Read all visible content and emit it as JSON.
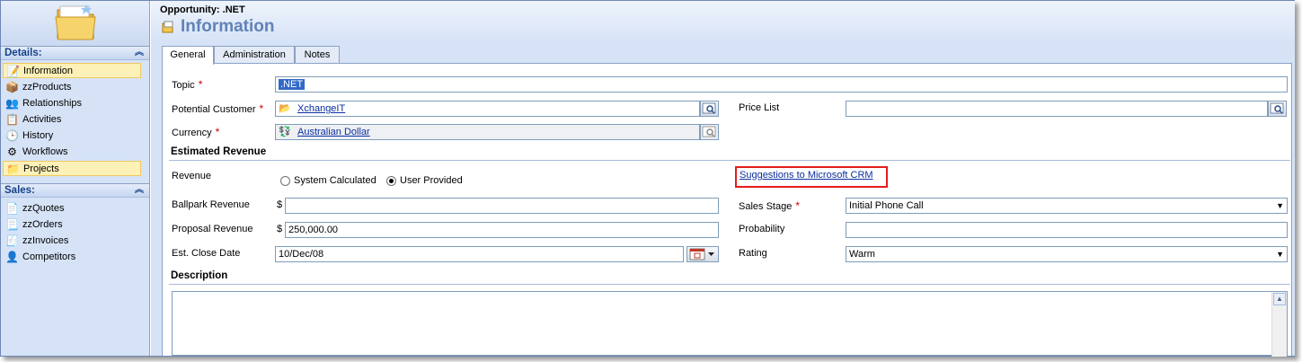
{
  "header": {
    "entity": "Opportunity: .NET",
    "title": "Information"
  },
  "sidebar": {
    "details_title": "Details:",
    "details_items": [
      {
        "label": "Information",
        "icon": "information-icon"
      },
      {
        "label": "zzProducts",
        "icon": "products-icon"
      },
      {
        "label": "Relationships",
        "icon": "relationships-icon"
      },
      {
        "label": "Activities",
        "icon": "activities-icon"
      },
      {
        "label": "History",
        "icon": "history-icon"
      },
      {
        "label": "Workflows",
        "icon": "workflows-icon"
      },
      {
        "label": "Projects",
        "icon": "projects-icon"
      }
    ],
    "sales_title": "Sales:",
    "sales_items": [
      {
        "label": "zzQuotes",
        "icon": "quotes-icon"
      },
      {
        "label": "zzOrders",
        "icon": "orders-icon"
      },
      {
        "label": "zzInvoices",
        "icon": "invoices-icon"
      },
      {
        "label": "Competitors",
        "icon": "competitors-icon"
      }
    ]
  },
  "tabs": [
    {
      "label": "General"
    },
    {
      "label": "Administration"
    },
    {
      "label": "Notes"
    }
  ],
  "form": {
    "topic_label": "Topic",
    "topic_value": ".NET",
    "customer_label": "Potential Customer",
    "customer_value": "XchangeIT",
    "currency_label": "Currency",
    "currency_value": "Australian Dollar",
    "pricelist_label": "Price List",
    "pricelist_value": "",
    "required_mark": "*",
    "section_revenue": "Estimated Revenue",
    "revenue_label": "Revenue",
    "revenue_opt1": "System Calculated",
    "revenue_opt2": "User Provided",
    "suggest_link": "Suggestions to Microsoft CRM",
    "ballpark_label": "Ballpark Revenue",
    "ballpark_currency": "$",
    "ballpark_value": "",
    "proposal_label": "Proposal Revenue",
    "proposal_currency": "$",
    "proposal_value": "250,000.00",
    "close_label": "Est. Close Date",
    "close_value": "10/Dec/08",
    "stage_label": "Sales Stage",
    "stage_value": "Initial Phone Call",
    "probability_label": "Probability",
    "probability_value": "",
    "rating_label": "Rating",
    "rating_value": "Warm",
    "section_description": "Description"
  },
  "colors": {
    "accent": "#6183b8",
    "required": "#cc0000",
    "highlight_box": "#e41c1c",
    "selected_nav": "#fdf1b7"
  }
}
